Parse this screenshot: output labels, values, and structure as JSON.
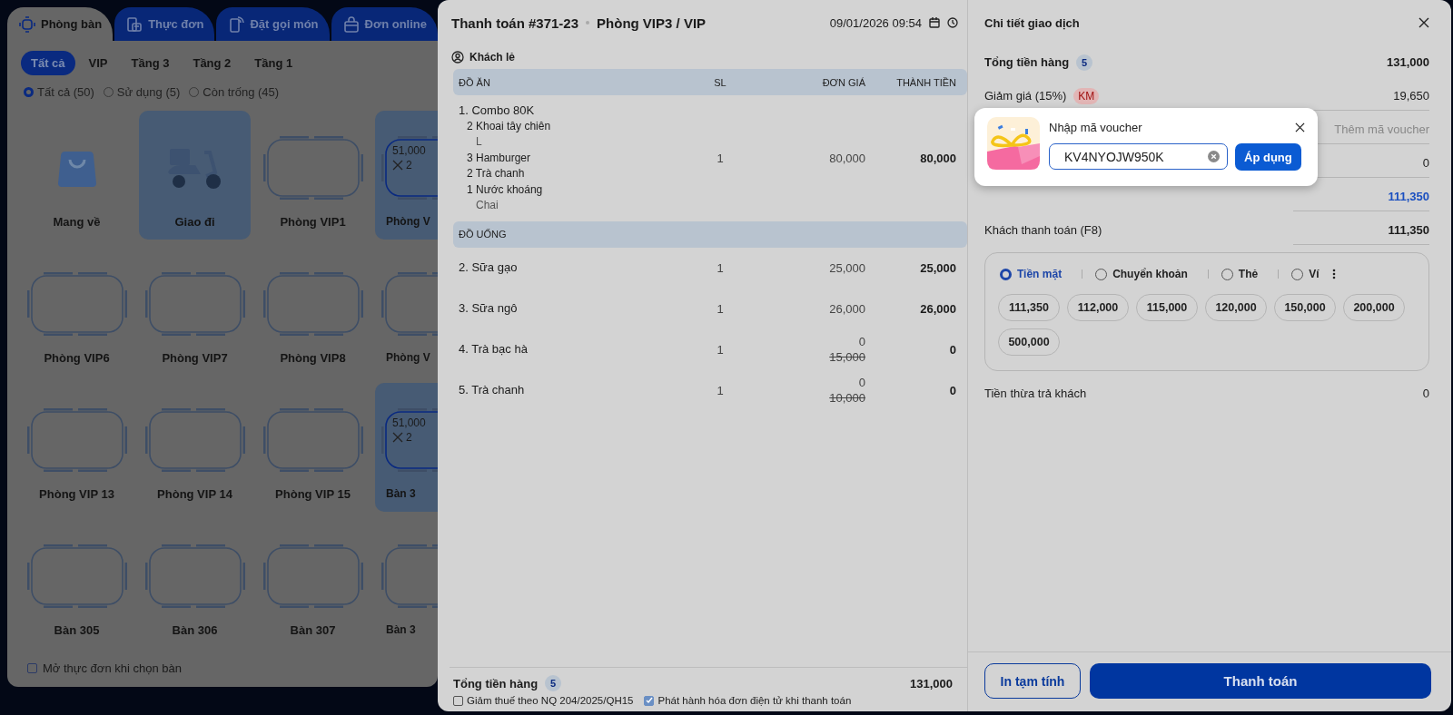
{
  "tabs": [
    {
      "label": "Phòng bàn",
      "selected": true,
      "kind": "tables"
    },
    {
      "label": "Thực đơn",
      "selected": false,
      "kind": "menu"
    },
    {
      "label": "Đặt gọi món",
      "selected": false,
      "kind": "phone"
    },
    {
      "label": "Đơn online",
      "selected": false,
      "kind": "bag"
    }
  ],
  "areas": [
    {
      "label": "Tất cả",
      "selected": true
    },
    {
      "label": "VIP",
      "selected": false
    },
    {
      "label": "Tầng 3",
      "selected": false
    },
    {
      "label": "Tầng 2",
      "selected": false
    },
    {
      "label": "Tầng 1",
      "selected": false
    }
  ],
  "status_filters": [
    {
      "label": "Tất cả (50)",
      "selected": true
    },
    {
      "label": "Sử dụng (5)",
      "selected": false
    },
    {
      "label": "Còn trống (45)",
      "selected": false
    }
  ],
  "tiles": [
    {
      "kind": "takeaway",
      "label": "Mang về",
      "active": false
    },
    {
      "kind": "delivery",
      "label": "Giao đi",
      "active": true
    },
    {
      "kind": "table",
      "label": "Phòng VIP1",
      "active": false
    },
    {
      "kind": "table",
      "label": "Phòng V",
      "active": true,
      "amount": "51,000",
      "guests": "2"
    },
    {
      "kind": "table",
      "label": "Phòng VIP6",
      "active": false
    },
    {
      "kind": "table",
      "label": "Phòng VIP7",
      "active": false
    },
    {
      "kind": "table",
      "label": "Phòng VIP8",
      "active": false
    },
    {
      "kind": "table",
      "label": "Phòng V",
      "active": false
    },
    {
      "kind": "table",
      "label": "Phòng VIP 13",
      "active": false
    },
    {
      "kind": "table",
      "label": "Phòng VIP 14",
      "active": false
    },
    {
      "kind": "table",
      "label": "Phòng VIP 15",
      "active": false
    },
    {
      "kind": "table",
      "label": "Bàn 3",
      "active": true,
      "amount": "51,000",
      "guests": "2"
    },
    {
      "kind": "table",
      "label": "Bàn 305",
      "active": false
    },
    {
      "kind": "table",
      "label": "Bàn 306",
      "active": false
    },
    {
      "kind": "table",
      "label": "Bàn 307",
      "active": false
    },
    {
      "kind": "table",
      "label": "Bàn 3",
      "active": false
    }
  ],
  "open_menu_option": {
    "label": "Mở thực đơn khi chọn bàn",
    "checked": false
  },
  "checkout": {
    "title": "Thanh toán #371-23",
    "room": "Phòng VIP3 / VIP",
    "datetime": "09/01/2026 09:54",
    "customer": "Khách lẻ",
    "sections": [
      {
        "header": "ĐỒ ĂN",
        "columns": [
          "SL",
          "ĐƠN GIÁ",
          "THÀNH TIỀN"
        ],
        "items": [
          {
            "name": "1. Combo 80K",
            "qty": "1",
            "price": "80,000",
            "total": "80,000",
            "components": [
              {
                "name": "2 Khoai tây chiên",
                "note": "L"
              },
              {
                "name": "3 Hamburger"
              },
              {
                "name": "2 Trà chanh"
              },
              {
                "name": "1 Nước khoáng",
                "note": "Chai"
              }
            ]
          }
        ]
      },
      {
        "header": "ĐỒ UỐNG",
        "items": [
          {
            "name": "2. Sữa gạo",
            "qty": "1",
            "price": "25,000",
            "total": "25,000"
          },
          {
            "name": "3. Sữa ngô",
            "qty": "1",
            "price": "26,000",
            "total": "26,000"
          },
          {
            "name": "4. Trà bạc hà",
            "qty": "1",
            "price": "0",
            "original_price": "15,000",
            "total": "0"
          },
          {
            "name": "5. Trà chanh",
            "qty": "1",
            "price": "0",
            "original_price": "10,000",
            "total": "0"
          }
        ]
      }
    ],
    "footer": {
      "label": "Tổng tiền hàng",
      "count": "5",
      "total": "131,000",
      "options": [
        {
          "label": "Giảm thuế theo NQ 204/2025/QH15",
          "checked": false
        },
        {
          "label": "Phát hành hóa đơn điện tử khi thanh toán",
          "checked": true
        }
      ]
    }
  },
  "details": {
    "title": "Chi tiết giao dịch",
    "rows": [
      {
        "kind": "total",
        "label": "Tổng tiền hàng",
        "count": "5",
        "value": "131,000"
      },
      {
        "kind": "discount",
        "label": "Giảm giá (15%)",
        "tag": "KM",
        "value": "19,650"
      },
      {
        "kind": "voucher",
        "placeholder": "Thêm mã voucher"
      },
      {
        "kind": "plain",
        "value": "0"
      },
      {
        "kind": "due",
        "value": "111,350"
      },
      {
        "kind": "paid",
        "label": "Khách thanh toán (F8)",
        "value": "111,350"
      }
    ],
    "payment_methods": [
      {
        "label": "Tiền mặt",
        "selected": true
      },
      {
        "label": "Chuyển khoản",
        "selected": false
      },
      {
        "label": "Thẻ",
        "selected": false
      },
      {
        "label": "Ví",
        "selected": false
      }
    ],
    "quick_amounts": [
      "111,350",
      "112,000",
      "115,000",
      "120,000",
      "150,000",
      "200,000",
      "500,000"
    ],
    "change": {
      "label": "Tiền thừa trả khách",
      "value": "0"
    },
    "print_button": "In tạm tính",
    "pay_button": "Thanh toán"
  },
  "voucher_popup": {
    "title": "Nhập mã voucher",
    "code": "KV4NYOJW950K",
    "apply_button": "Áp dụng"
  }
}
